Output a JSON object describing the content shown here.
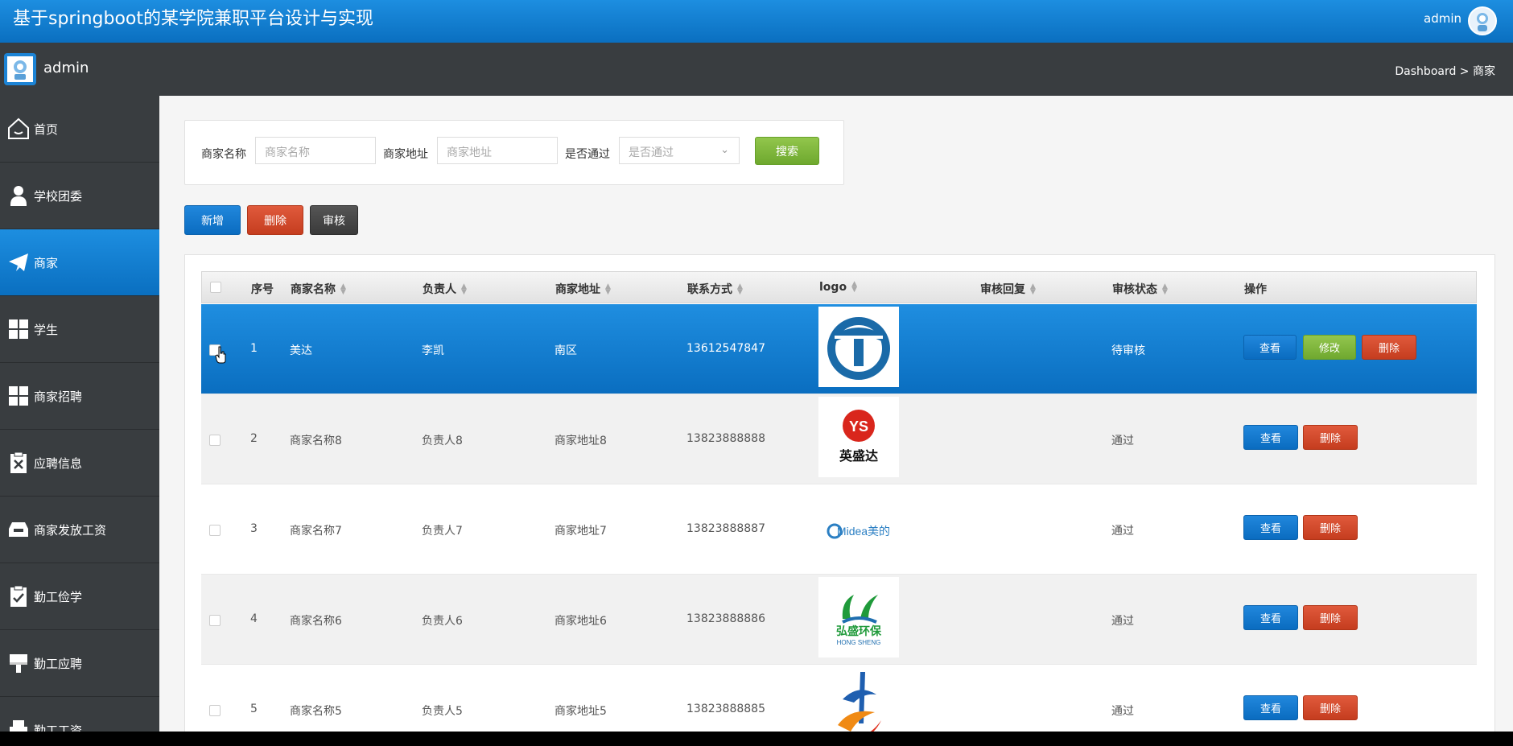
{
  "app": {
    "title": "基于springboot的某学院兼职平台设计与实现",
    "user": "admin"
  },
  "subbar": {
    "username": "admin",
    "breadcrumb": "Dashboard > 商家"
  },
  "sidebar": {
    "items": [
      {
        "label": "首页",
        "icon": "home-icon"
      },
      {
        "label": "学校团委",
        "icon": "user-icon"
      },
      {
        "label": "商家",
        "icon": "send-icon",
        "active": true
      },
      {
        "label": "学生",
        "icon": "grid-icon"
      },
      {
        "label": "商家招聘",
        "icon": "grid-icon"
      },
      {
        "label": "应聘信息",
        "icon": "clipboard-x-icon"
      },
      {
        "label": "商家发放工资",
        "icon": "inbox-icon"
      },
      {
        "label": "勤工俭学",
        "icon": "clipboard-check-icon"
      },
      {
        "label": "勤工应聘",
        "icon": "brush-icon"
      },
      {
        "label": "勤工工资",
        "icon": "printer-icon"
      }
    ]
  },
  "search": {
    "name_label": "商家名称",
    "name_placeholder": "商家名称",
    "addr_label": "商家地址",
    "addr_placeholder": "商家地址",
    "pass_label": "是否通过",
    "pass_placeholder": "是否通过",
    "search_button": "搜索"
  },
  "toolbar": {
    "add": "新增",
    "delete": "删除",
    "audit": "审核"
  },
  "table": {
    "headers": [
      "序号",
      "商家名称",
      "负责人",
      "商家地址",
      "联系方式",
      "logo",
      "审核回复",
      "审核状态",
      "操作"
    ],
    "rows": [
      {
        "no": "1",
        "name": "美达",
        "owner": "李凯",
        "addr": "南区",
        "phone": "13612547847",
        "reply": "",
        "status": "待审核",
        "logo": "blue-circle-logo"
      },
      {
        "no": "2",
        "name": "商家名称8",
        "owner": "负责人8",
        "addr": "商家地址8",
        "phone": "13823888888",
        "reply": "",
        "status": "通过",
        "logo": "yingshengda-logo",
        "logo_text": "英盛达"
      },
      {
        "no": "3",
        "name": "商家名称7",
        "owner": "负责人7",
        "addr": "商家地址7",
        "phone": "13823888887",
        "reply": "",
        "status": "通过",
        "logo": "midea-logo",
        "logo_text": "Midea美的"
      },
      {
        "no": "4",
        "name": "商家名称6",
        "owner": "负责人6",
        "addr": "商家地址6",
        "phone": "13823888886",
        "reply": "",
        "status": "通过",
        "logo": "hongsheng-logo",
        "logo_text": "弘盛环保",
        "logo_sub": "HONG SHENG"
      },
      {
        "no": "5",
        "name": "商家名称5",
        "owner": "负责人5",
        "addr": "商家地址5",
        "phone": "13823888885",
        "reply": "",
        "status": "通过",
        "logo": "colorful-logo"
      }
    ],
    "actions": {
      "view": "查看",
      "edit": "修改",
      "delete": "删除"
    }
  },
  "colors": {
    "primary": "#0a6fc0",
    "danger": "#c53d1f",
    "success": "#6fa82f",
    "sidebar": "#393d40"
  }
}
